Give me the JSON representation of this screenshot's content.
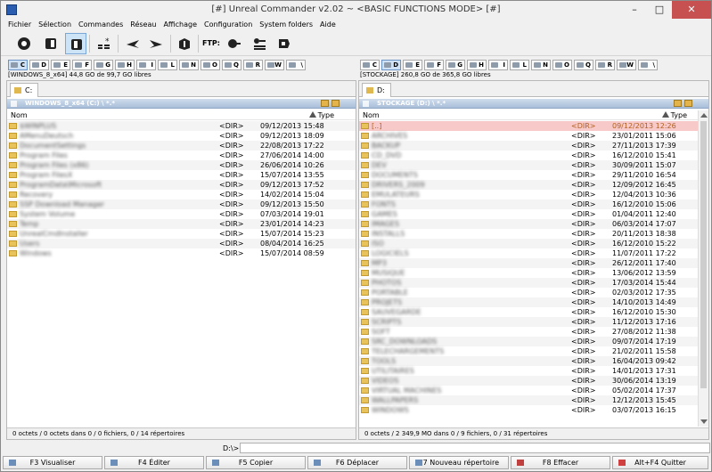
{
  "window": {
    "title": "[#] Unreal Commander v2.02 ~ <BASIC FUNCTIONS MODE> [#]"
  },
  "menu": [
    "Fichier",
    "Sélection",
    "Commandes",
    "Réseau",
    "Affichage",
    "Configuration",
    "System folders",
    "Aide"
  ],
  "toolbar": {
    "ftp_label": "FTP:"
  },
  "left": {
    "drives": [
      "C",
      "D",
      "E",
      "F",
      "G",
      "H",
      "I",
      "L",
      "N",
      "O",
      "Q",
      "R",
      "W",
      "\\"
    ],
    "free_info": "[WINDOWS_8_x64]  44,8 GO  de 99,7 GO  libres",
    "tab_label": "C:",
    "path": "WINDOWS_8_x64 (C:)  \\  *.*",
    "columns": {
      "name": "Nom",
      "type": "Type"
    },
    "rows": [
      {
        "name": "$WINPLUS",
        "type": "<DIR>",
        "date": "09/12/2013 15:48"
      },
      {
        "name": "AMenuDeutsch",
        "type": "<DIR>",
        "date": "09/12/2013 18:09"
      },
      {
        "name": "DocumentSettings",
        "type": "<DIR>",
        "date": "22/08/2013 17:22"
      },
      {
        "name": "Program Files",
        "type": "<DIR>",
        "date": "27/06/2014 14:00"
      },
      {
        "name": "Program Files (x86)",
        "type": "<DIR>",
        "date": "26/06/2014 10:26"
      },
      {
        "name": "Program FilesX",
        "type": "<DIR>",
        "date": "15/07/2014 13:55"
      },
      {
        "name": "ProgramData\\Microsoft",
        "type": "<DIR>",
        "date": "09/12/2013 17:52"
      },
      {
        "name": "Recovery",
        "type": "<DIR>",
        "date": "14/02/2014 15:04"
      },
      {
        "name": "SSP Download Manager",
        "type": "<DIR>",
        "date": "09/12/2013 15:50"
      },
      {
        "name": "System Volume",
        "type": "<DIR>",
        "date": "07/03/2014 19:01"
      },
      {
        "name": "Temp",
        "type": "<DIR>",
        "date": "23/01/2014 14:23"
      },
      {
        "name": "UnrealCmdInstaller",
        "type": "<DIR>",
        "date": "15/07/2014 15:23"
      },
      {
        "name": "Users",
        "type": "<DIR>",
        "date": "08/04/2014 16:25"
      },
      {
        "name": "Windows",
        "type": "<DIR>",
        "date": "15/07/2014 08:59"
      }
    ],
    "status": "0 octets / 0 octets dans 0 / 0 fichiers, 0 / 14 répertoires"
  },
  "right": {
    "drives": [
      "C",
      "D",
      "E",
      "F",
      "G",
      "H",
      "I",
      "L",
      "N",
      "O",
      "Q",
      "R",
      "W",
      "\\"
    ],
    "free_info": "[STOCKAGE]  260,8 GO  de 365,8 GO  libres",
    "tab_label": "D:",
    "path": "STOCKAGE (D:)  \\  *.*",
    "columns": {
      "name": "Nom",
      "type": "Type"
    },
    "rows": [
      {
        "name": "[..]",
        "type": "<DIR>",
        "date": "09/12/2013 12:26"
      },
      {
        "name": "ARCHIVES",
        "type": "<DIR>",
        "date": "23/01/2011 15:06"
      },
      {
        "name": "BACKUP",
        "type": "<DIR>",
        "date": "27/11/2013 17:39"
      },
      {
        "name": "CD_DVD",
        "type": "<DIR>",
        "date": "16/12/2010 15:41"
      },
      {
        "name": "DEV",
        "type": "<DIR>",
        "date": "30/09/2011 15:07"
      },
      {
        "name": "DOCUMENTS",
        "type": "<DIR>",
        "date": "29/11/2010 16:54"
      },
      {
        "name": "DRIVERS_2009",
        "type": "<DIR>",
        "date": "12/09/2012 16:45"
      },
      {
        "name": "EMULATEURS",
        "type": "<DIR>",
        "date": "12/04/2013 10:36"
      },
      {
        "name": "FONTS",
        "type": "<DIR>",
        "date": "16/12/2010 15:06"
      },
      {
        "name": "GAMES",
        "type": "<DIR>",
        "date": "01/04/2011 12:40"
      },
      {
        "name": "IMAGES",
        "type": "<DIR>",
        "date": "06/03/2014 17:07"
      },
      {
        "name": "INSTALLS",
        "type": "<DIR>",
        "date": "20/11/2013 18:38"
      },
      {
        "name": "ISO",
        "type": "<DIR>",
        "date": "16/12/2010 15:22"
      },
      {
        "name": "LOGICIELS",
        "type": "<DIR>",
        "date": "11/07/2011 17:22"
      },
      {
        "name": "MP3",
        "type": "<DIR>",
        "date": "26/12/2011 17:40"
      },
      {
        "name": "MUSIQUE",
        "type": "<DIR>",
        "date": "13/06/2012 13:59"
      },
      {
        "name": "PHOTOS",
        "type": "<DIR>",
        "date": "17/03/2014 15:44"
      },
      {
        "name": "PORTABLE",
        "type": "<DIR>",
        "date": "02/03/2012 17:35"
      },
      {
        "name": "PROJETS",
        "type": "<DIR>",
        "date": "14/10/2013 14:49"
      },
      {
        "name": "SAUVEGARDE",
        "type": "<DIR>",
        "date": "16/12/2010 15:30"
      },
      {
        "name": "SCRIPTS",
        "type": "<DIR>",
        "date": "11/12/2013 17:16"
      },
      {
        "name": "SOFT",
        "type": "<DIR>",
        "date": "27/08/2012 11:38"
      },
      {
        "name": "SRC_DOWNLOADS",
        "type": "<DIR>",
        "date": "09/07/2014 17:19"
      },
      {
        "name": "TELECHARGEMENTS",
        "type": "<DIR>",
        "date": "21/02/2011 15:58"
      },
      {
        "name": "TOOLS",
        "type": "<DIR>",
        "date": "16/04/2013 09:42"
      },
      {
        "name": "UTILITAIRES",
        "type": "<DIR>",
        "date": "14/01/2013 17:31"
      },
      {
        "name": "VIDEOS",
        "type": "<DIR>",
        "date": "30/06/2014 13:19"
      },
      {
        "name": "VIRTUAL MACHINES",
        "type": "<DIR>",
        "date": "05/02/2014 17:37"
      },
      {
        "name": "WALLPAPERS",
        "type": "<DIR>",
        "date": "12/12/2013 15:45"
      },
      {
        "name": "WINDOWS",
        "type": "<DIR>",
        "date": "03/07/2013 16:15"
      }
    ],
    "status": "0 octets / 2 349,9 MO dans 0 / 9 fichiers, 0 / 31 répertoires"
  },
  "cmdline": {
    "prompt": "D:\\>",
    "value": ""
  },
  "fkeys": [
    "F3 Visualiser",
    "F4 Éditer",
    "F5 Copier",
    "F6 Déplacer",
    "F7 Nouveau répertoire",
    "F8 Effacer",
    "Alt+F4 Quitter"
  ],
  "colors": {
    "accent": "#cde4f7",
    "path_bar": "#a9bfd9",
    "highlight_row": "#f7c9c9",
    "folder": "#e8c25a",
    "close": "#c75050"
  }
}
